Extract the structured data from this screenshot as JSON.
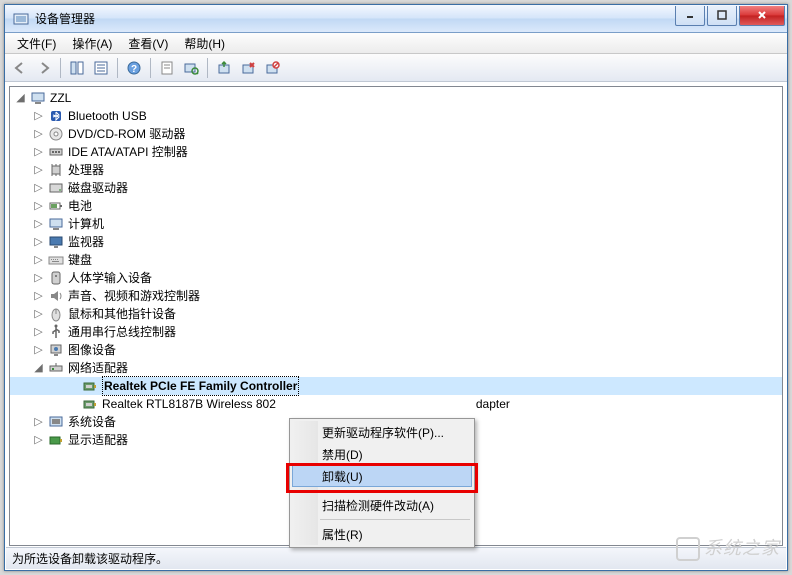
{
  "window": {
    "title": "设备管理器"
  },
  "menu": {
    "file": "文件(F)",
    "action": "操作(A)",
    "view": "查看(V)",
    "help": "帮助(H)"
  },
  "tree": {
    "root": "ZZL",
    "categories": [
      {
        "label": "Bluetooth USB",
        "expanded": false
      },
      {
        "label": "DVD/CD-ROM 驱动器",
        "expanded": false
      },
      {
        "label": "IDE ATA/ATAPI 控制器",
        "expanded": false
      },
      {
        "label": "处理器",
        "expanded": false
      },
      {
        "label": "磁盘驱动器",
        "expanded": false
      },
      {
        "label": "电池",
        "expanded": false
      },
      {
        "label": "计算机",
        "expanded": false
      },
      {
        "label": "监视器",
        "expanded": false
      },
      {
        "label": "键盘",
        "expanded": false
      },
      {
        "label": "人体学输入设备",
        "expanded": false
      },
      {
        "label": "声音、视频和游戏控制器",
        "expanded": false
      },
      {
        "label": "鼠标和其他指针设备",
        "expanded": false
      },
      {
        "label": "通用串行总线控制器",
        "expanded": false
      },
      {
        "label": "图像设备",
        "expanded": false
      },
      {
        "label": "网络适配器",
        "expanded": true,
        "children": [
          {
            "label": "Realtek PCIe FE Family Controller",
            "selected": true
          },
          {
            "label": "Realtek RTL8187B Wireless 802",
            "tail": "dapter"
          }
        ]
      },
      {
        "label": "系统设备",
        "expanded": false
      },
      {
        "label": "显示适配器",
        "expanded": false
      }
    ]
  },
  "context_menu": {
    "items": [
      {
        "label": "更新驱动程序软件(P)..."
      },
      {
        "label": "禁用(D)"
      },
      {
        "label": "卸载(U)",
        "highlighted": true
      },
      {
        "sep": true
      },
      {
        "label": "扫描检测硬件改动(A)"
      },
      {
        "sep": true
      },
      {
        "label": "属性(R)"
      }
    ]
  },
  "status": "为所选设备卸载该驱动程序。",
  "watermark": "系统之家"
}
